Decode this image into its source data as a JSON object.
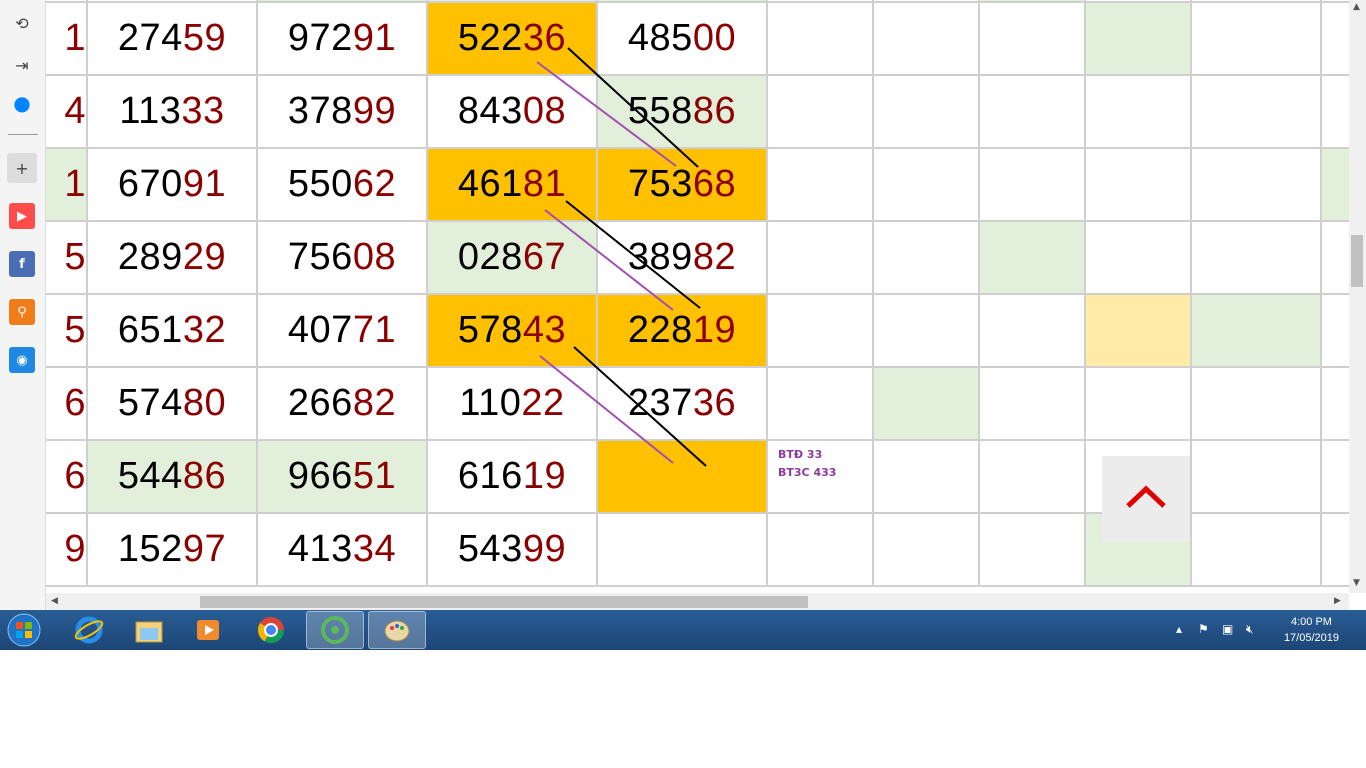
{
  "sidebar": {
    "items": [
      {
        "icon": "history-icon"
      },
      {
        "icon": "sign-in-icon"
      },
      {
        "icon": "messenger-icon",
        "color": "#0084ff"
      },
      {
        "icon": "plus-icon"
      },
      {
        "icon": "youtube-icon",
        "color": "#ff0000"
      },
      {
        "icon": "facebook-icon",
        "color": "#3b5998"
      },
      {
        "icon": "search-icon",
        "color": "#f07d1a"
      },
      {
        "icon": "music-icon",
        "color": "#1e88e5"
      }
    ]
  },
  "table": {
    "partial_col": [
      "1",
      "4",
      "1",
      "5",
      "5",
      "6",
      "6",
      "9"
    ],
    "rows": [
      [
        {
          "h": "274",
          "t": "59"
        },
        {
          "h": "972",
          "t": "91"
        },
        {
          "h": "522",
          "t": "36"
        },
        {
          "h": "485",
          "t": "00"
        }
      ],
      [
        {
          "h": "113",
          "t": "33"
        },
        {
          "h": "378",
          "t": "99"
        },
        {
          "h": "843",
          "t": "08"
        },
        {
          "h": "558",
          "t": "86"
        }
      ],
      [
        {
          "h": "670",
          "t": "91"
        },
        {
          "h": "550",
          "t": "62"
        },
        {
          "h": "461",
          "t": "81"
        },
        {
          "h": "753",
          "t": "68"
        }
      ],
      [
        {
          "h": "289",
          "t": "29"
        },
        {
          "h": "756",
          "t": "08"
        },
        {
          "h": "028",
          "t": "67"
        },
        {
          "h": "389",
          "t": "82"
        }
      ],
      [
        {
          "h": "651",
          "t": "32"
        },
        {
          "h": "407",
          "t": "71"
        },
        {
          "h": "578",
          "t": "43"
        },
        {
          "h": "228",
          "t": "19"
        }
      ],
      [
        {
          "h": "574",
          "t": "80"
        },
        {
          "h": "266",
          "t": "82"
        },
        {
          "h": "110",
          "t": "22"
        },
        {
          "h": "237",
          "t": "36"
        }
      ],
      [
        {
          "h": "544",
          "t": "86"
        },
        {
          "h": "966",
          "t": "51"
        },
        {
          "h": "616",
          "t": "19"
        },
        {
          "h": "",
          "t": ""
        }
      ],
      [
        {
          "h": "152",
          "t": "97"
        },
        {
          "h": "413",
          "t": "34"
        },
        {
          "h": "543",
          "t": "99"
        },
        {
          "h": "",
          "t": ""
        }
      ]
    ]
  },
  "note": {
    "line1": "BTĐ 33",
    "line2": "BT3C 433"
  },
  "scroll_top": {
    "icon": "chevron-up-icon"
  },
  "colors": {
    "orange": "#ffc000",
    "green": "#e2efda",
    "tail": "#8b0000",
    "note": "#8e3a9e"
  },
  "taskbar": {
    "apps": [
      "internet-explorer-icon",
      "file-explorer-icon",
      "media-player-icon",
      "chrome-icon",
      "coccoc-icon",
      "paint-icon"
    ],
    "time": "4:00 PM",
    "date": "17/05/2019"
  }
}
